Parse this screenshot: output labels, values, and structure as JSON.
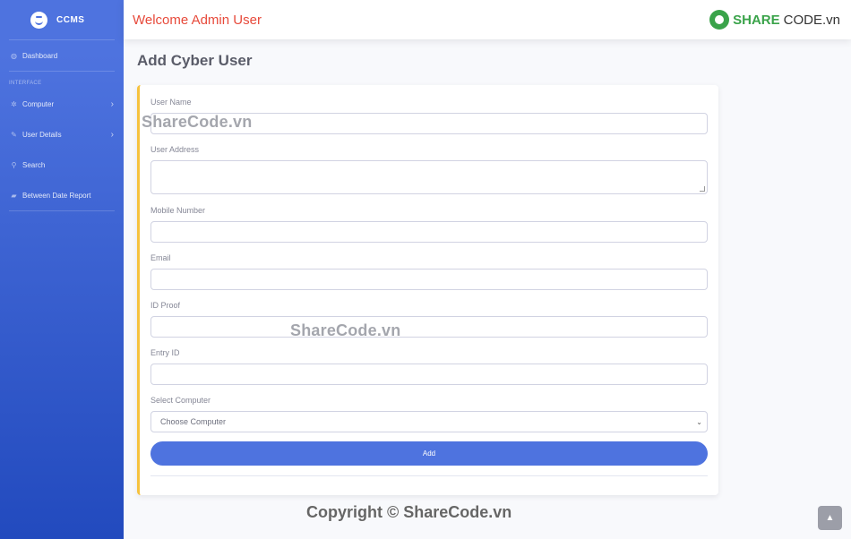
{
  "brand": {
    "name": "CCMS"
  },
  "sidebar": {
    "dashboard": {
      "label": "Dashboard",
      "icon": "dashboard-icon"
    },
    "heading": "INTERFACE",
    "items": [
      {
        "label": "Computer",
        "icon": "gear-icon",
        "chevron": "›"
      },
      {
        "label": "User Details",
        "icon": "wrench-icon",
        "chevron": "›"
      },
      {
        "label": "Search",
        "icon": "search-icon"
      },
      {
        "label": "Between Date Report",
        "icon": "folder-icon"
      }
    ]
  },
  "topbar": {
    "welcome": "Welcome  Admin User"
  },
  "watermark_logo": {
    "part1": "SHARE",
    "part2": "CODE.vn"
  },
  "page": {
    "title": "Add Cyber User"
  },
  "form": {
    "user_name": {
      "label": "User Name",
      "value": ""
    },
    "user_address": {
      "label": "User Address",
      "value": ""
    },
    "mobile": {
      "label": "Mobile Number",
      "value": ""
    },
    "email": {
      "label": "Email",
      "value": ""
    },
    "id_proof": {
      "label": "ID Proof",
      "value": ""
    },
    "entry_id": {
      "label": "Entry ID",
      "value": ""
    },
    "computer": {
      "label": "Select Computer",
      "selected": "Choose Computer"
    },
    "submit_label": "Add"
  },
  "watermarks": [
    "ShareCode.vn",
    "ShareCode.vn"
  ],
  "copyright": "Copyright © ShareCode.vn",
  "colors": {
    "primary": "#4e73df",
    "accent": "#f6c23e",
    "welcome": "#e74a3b"
  }
}
